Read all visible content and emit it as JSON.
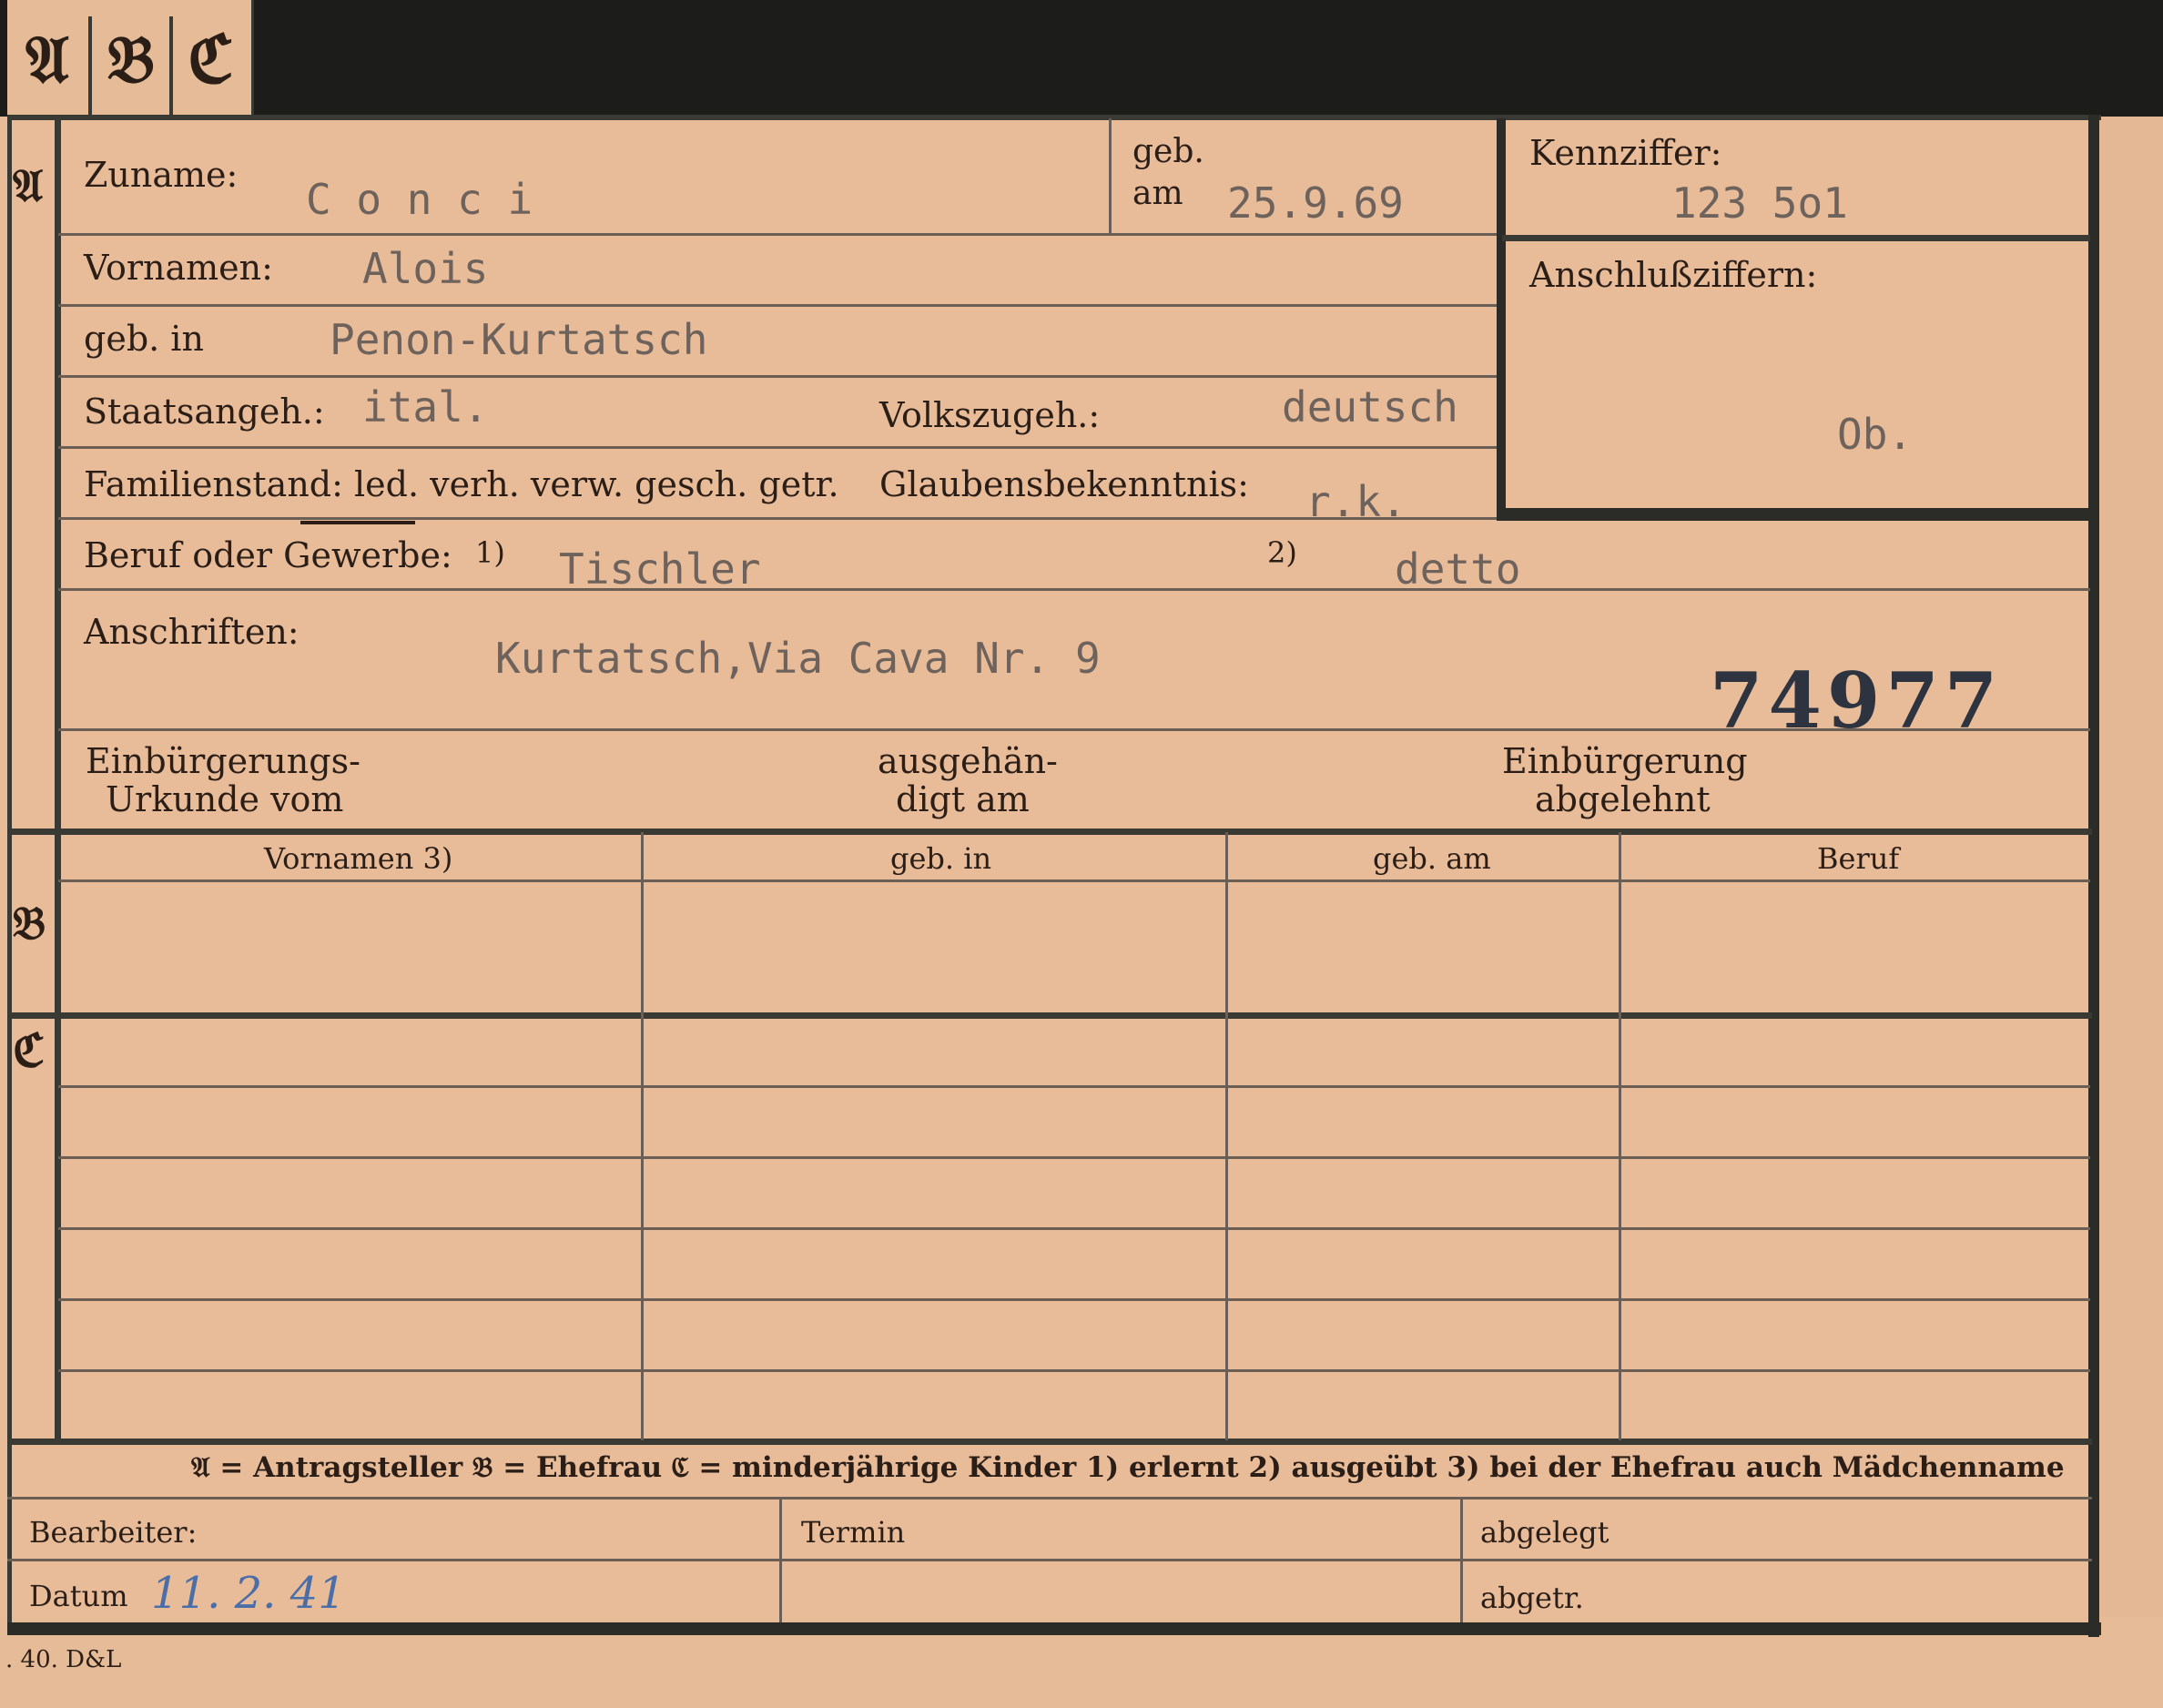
{
  "tabs": [
    "𝔄",
    "𝔅",
    "ℭ"
  ],
  "section_markers": {
    "a": "𝔄",
    "b": "𝔅",
    "c": "ℭ"
  },
  "fields": {
    "zuname_label": "Zuname:",
    "zuname_value": "C o n c i",
    "geb_label": "geb.",
    "am_label": "am",
    "geb_am_value": "25.9.69",
    "kennziffer_label": "Kennziffer:",
    "kennziffer_value": "123 5o1",
    "vornamen_label": "Vornamen:",
    "vornamen_value": "Alois",
    "anschluss_label": "Anschlußziffern:",
    "anschluss_value": "Ob.",
    "geb_in_label": "geb. in",
    "geb_in_value": "Penon-Kurtatsch",
    "staatsangeh_label": "Staatsangeh.:",
    "staatsangeh_value": "ital.",
    "volkszugeh_label": "Volkszugeh.:",
    "volkszugeh_value": "deutsch",
    "familienstand_label": "Familienstand: led. verh. verw. gesch. getr.",
    "glaubens_label": "Glaubensbekenntnis:",
    "glaubens_value": "r.k.",
    "beruf_label": "Beruf oder Gewerbe:",
    "beruf_note1": "1)",
    "beruf_value1": "Tischler",
    "beruf_note2": "2)",
    "beruf_value2": "detto",
    "anschriften_label": "Anschriften:",
    "anschriften_value": "Kurtatsch,Via Cava Nr. 9",
    "stamp_number": "74977",
    "einb_urkunde_line1": "Einbürgerungs-",
    "einb_urkunde_line2": "Urkunde vom",
    "ausgehaendigt_line1": "ausgehän-",
    "ausgehaendigt_line2": "digt am",
    "einb_abgelehnt_line1": "Einbürgerung",
    "einb_abgelehnt_line2": "abgelehnt"
  },
  "table_headers": [
    "Vornamen 3)",
    "geb. in",
    "geb. am",
    "Beruf"
  ],
  "legend": "𝔄 = Antragsteller   𝔅 = Ehefrau   ℭ = minderjährige Kinder   1) erlernt   2) ausgeübt   3) bei der Ehefrau auch Mädchenname",
  "footer": {
    "bearbeiter_label": "Bearbeiter:",
    "datum_label": "Datum",
    "datum_value": "11. 2. 41",
    "termin_label": "Termin",
    "abgelegt_label": "abgelegt",
    "abgetr_label": "abgetr."
  },
  "print_mark": ". 40. D&L",
  "colors": {
    "card": "#e9bc99",
    "ink": "#2a1e17",
    "typewriter": "#6e625c",
    "blue_ink": "#4a6fa8",
    "stamp": "#2d3440",
    "background": "#1c1c1a"
  }
}
